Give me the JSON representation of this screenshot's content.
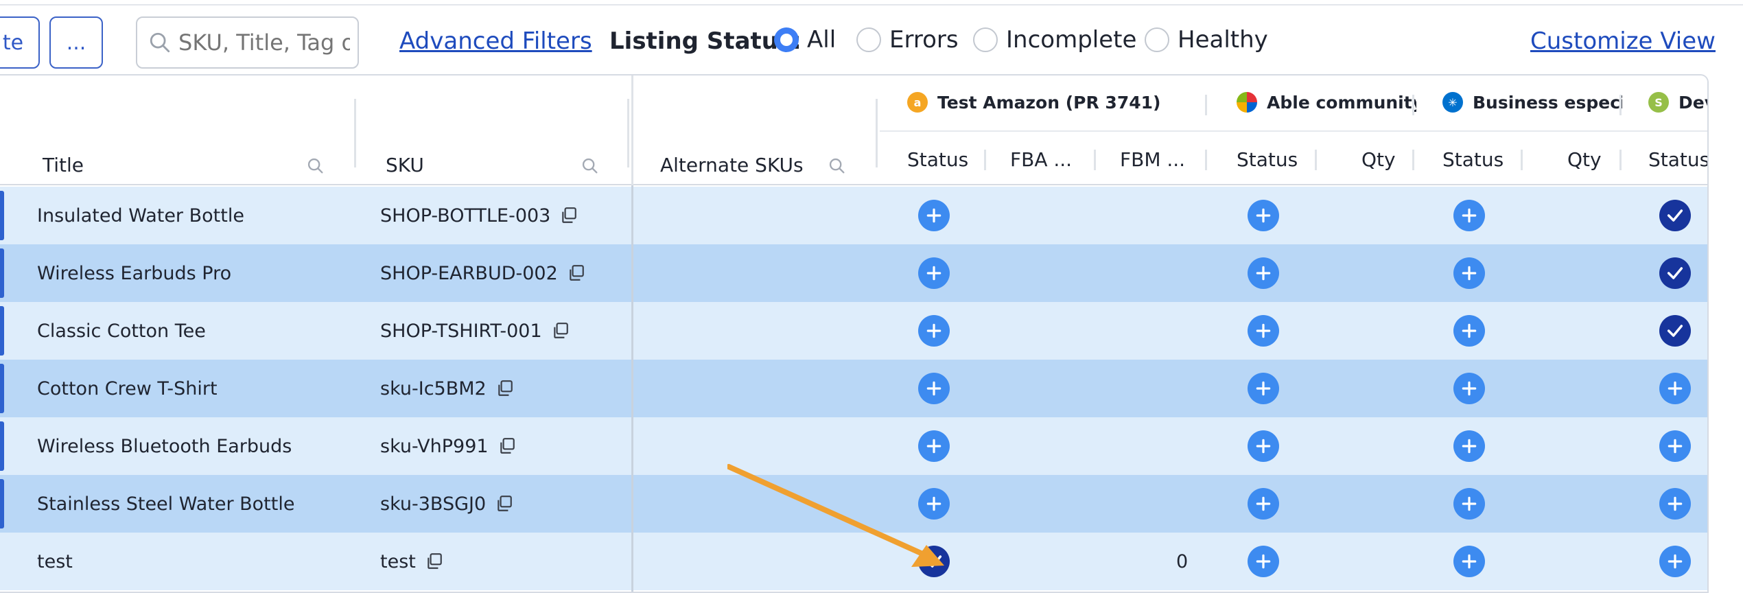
{
  "toolbar": {
    "partial_button_label": "te",
    "more_button_label": "...",
    "search_placeholder": "SKU, Title, Tag o",
    "advanced_filters_label": "Advanced Filters",
    "listing_status_label": "Listing Status:",
    "status_options": [
      {
        "label": "All",
        "selected": true
      },
      {
        "label": "Errors",
        "selected": false
      },
      {
        "label": "Incomplete",
        "selected": false
      },
      {
        "label": "Healthy",
        "selected": false
      }
    ],
    "customize_view_label": "Customize View"
  },
  "columns": {
    "title": "Title",
    "sku": "SKU",
    "alternate_skus": "Alternate SKUs"
  },
  "marketplaces": [
    {
      "name": "Test Amazon (PR 3741)",
      "icon": "amazon-icon",
      "color": "#f5a623"
    },
    {
      "name": "Able community bo",
      "icon": "ebay-icon",
      "color": "#e53238"
    },
    {
      "name": "Business especially.",
      "icon": "walmart-icon",
      "color": "#0071ce"
    },
    {
      "name": "Dev",
      "icon": "shopify-icon",
      "color": "#96bf48"
    }
  ],
  "subcolumns": [
    "Status",
    "FBA ...",
    "FBM ...",
    "Status",
    "Qty",
    "Status",
    "Qty",
    "Status"
  ],
  "rows": [
    {
      "title": "Insulated Water Bottle",
      "sku": "SHOP-BOTTLE-003",
      "statuses": [
        "plus",
        "plus",
        "plus",
        "check"
      ],
      "fbm": ""
    },
    {
      "title": "Wireless Earbuds Pro",
      "sku": "SHOP-EARBUD-002",
      "statuses": [
        "plus",
        "plus",
        "plus",
        "check"
      ],
      "fbm": ""
    },
    {
      "title": "Classic Cotton Tee",
      "sku": "SHOP-TSHIRT-001",
      "statuses": [
        "plus",
        "plus",
        "plus",
        "check"
      ],
      "fbm": ""
    },
    {
      "title": "Cotton Crew T-Shirt",
      "sku": "sku-Ic5BM2",
      "statuses": [
        "plus",
        "plus",
        "plus",
        "plus"
      ],
      "fbm": ""
    },
    {
      "title": "Wireless Bluetooth Earbuds",
      "sku": "sku-VhP991",
      "statuses": [
        "plus",
        "plus",
        "plus",
        "plus"
      ],
      "fbm": ""
    },
    {
      "title": "Stainless Steel Water Bottle",
      "sku": "sku-3BSGJ0",
      "statuses": [
        "plus",
        "plus",
        "plus",
        "plus"
      ],
      "fbm": ""
    },
    {
      "title": "test",
      "sku": "test",
      "statuses": [
        "check",
        "plus",
        "plus",
        "plus"
      ],
      "fbm": "0"
    }
  ],
  "colors": {
    "accent": "#3d8bf0",
    "check": "#17349c",
    "row_light": "#deedfb",
    "row_dark": "#b9d7f6",
    "annotation_arrow": "#f0a030"
  }
}
